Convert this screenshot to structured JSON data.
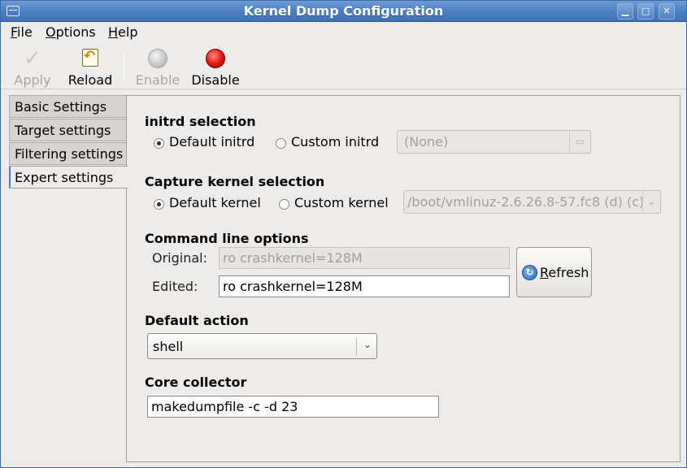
{
  "window": {
    "title": "Kernel Dump Configuration"
  },
  "menu": {
    "file": "File",
    "options": "Options",
    "help": "Help"
  },
  "toolbar": {
    "apply": "Apply",
    "reload": "Reload",
    "enable": "Enable",
    "disable": "Disable"
  },
  "tabs": [
    {
      "label": "Basic Settings"
    },
    {
      "label": "Target settings"
    },
    {
      "label": "Filtering settings"
    },
    {
      "label": "Expert settings"
    }
  ],
  "initrd": {
    "heading": "initrd selection",
    "default_label": "Default initrd",
    "custom_label": "Custom initrd",
    "selected": "default",
    "file_value": "(None)"
  },
  "kernel": {
    "heading": "Capture kernel selection",
    "default_label": "Default kernel",
    "custom_label": "Custom kernel",
    "selected": "default",
    "combo_value": "/boot/vmlinuz-2.6.26.8-57.fc8 (d) (c)"
  },
  "cmdline": {
    "heading": "Command line options",
    "original_label": "Original:",
    "original_value": "ro crashkernel=128M",
    "edited_label": "Edited:",
    "edited_value": "ro crashkernel=128M",
    "refresh_label": "Refresh"
  },
  "default_action": {
    "heading": "Default action",
    "value": "shell"
  },
  "core_collector": {
    "heading": "Core collector",
    "value": "makedumpfile -c -d 23"
  }
}
